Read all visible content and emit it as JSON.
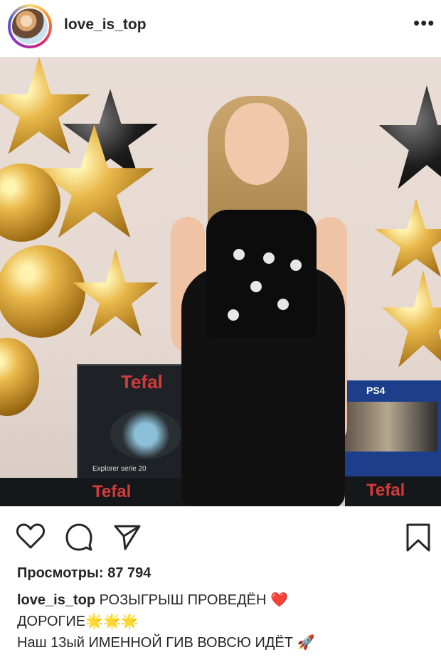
{
  "post": {
    "username": "love_is_top",
    "more_label": "•••",
    "views_label": "Просмотры:",
    "views_count": "87 794",
    "caption_user": "love_is_top",
    "caption_line1": "РОЗЫГРЫШ ПРОВЕДЁН ❤️",
    "caption_line2": "ДОРОГИЕ🌟🌟🌟",
    "caption_line3": "Наш 13ый ИМЕННОЙ ГИВ ВОВСЮ ИДЁТ 🚀"
  },
  "photo": {
    "brand_text": "Tefal",
    "ps4_text": "PS4",
    "box_small_text": "Explorer serie 20"
  },
  "icons": {
    "like": "heart-icon",
    "comment": "comment-icon",
    "share": "send-icon",
    "save": "bookmark-icon"
  },
  "colors": {
    "text": "#262626",
    "tefal_red": "#d33b3b",
    "gold": "#e9b84a"
  }
}
